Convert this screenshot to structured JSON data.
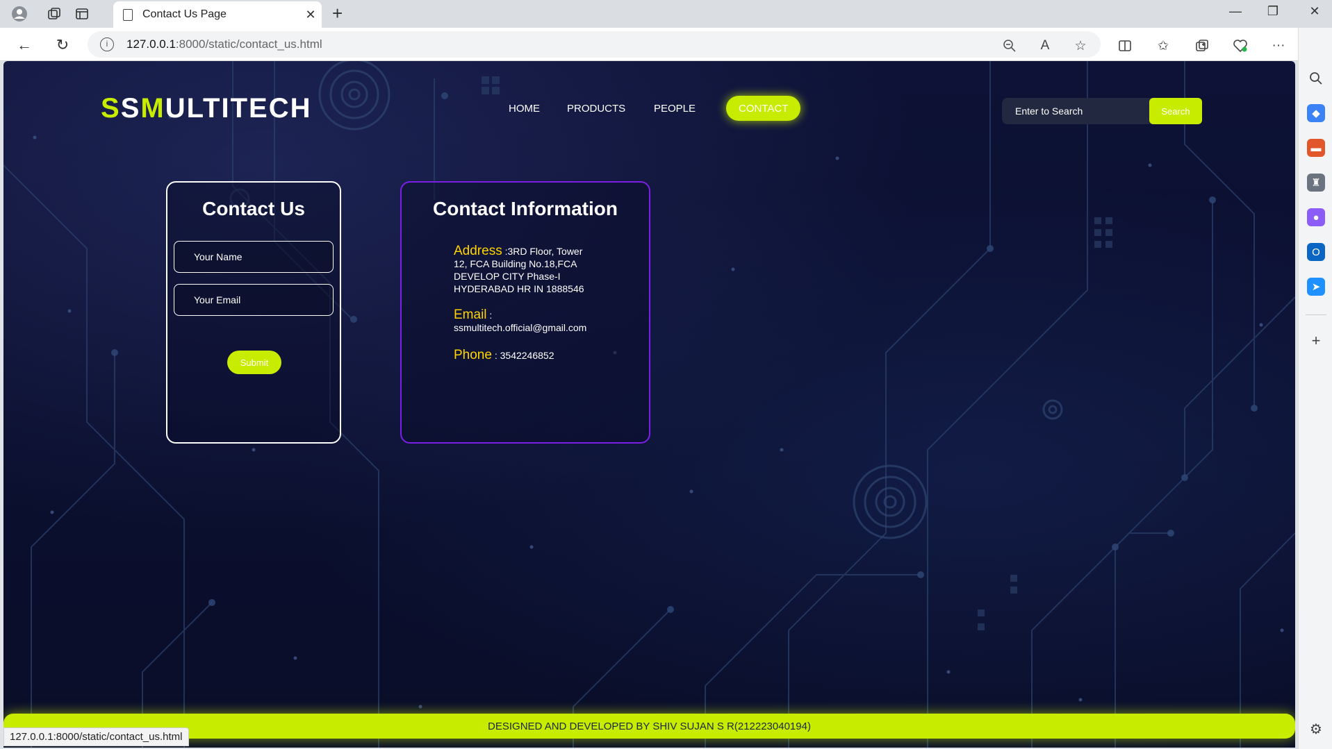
{
  "browser": {
    "tab_title": "Contact Us Page",
    "url_host": "127.0.0.1",
    "url_path": ":8000/static/contact_us.html",
    "status_url": "127.0.0.1:8000/static/contact_us.html"
  },
  "header": {
    "logo_prefix_1": "S",
    "logo_prefix_2": "S",
    "logo_prefix_3": "M",
    "logo_rest": "ULTITECH",
    "nav": {
      "home": "HOME",
      "products": "PRODUCTS",
      "people": "PEOPLE",
      "contact": "CONTACT"
    },
    "search_placeholder": "Enter to Search",
    "search_button": "Search"
  },
  "contact_form": {
    "title": "Contact Us",
    "name_placeholder": "Your Name",
    "email_placeholder": "Your Email",
    "submit_label": "Submit"
  },
  "contact_info": {
    "title": "Contact Information",
    "address_label": "Address",
    "address_first": " :3RD Floor, Tower",
    "address_rest": "12, FCA Building No.18,FCA DEVELOP CITY Phase-I HYDERABAD HR IN 1888546",
    "email_label": "Email",
    "email_sep": " :",
    "email_value": "ssmultitech.official@gmail.com",
    "phone_label": "Phone",
    "phone_value": " : 3542246852"
  },
  "footer": {
    "text": "DESIGNED AND DEVELOPED BY SHIV SUJAN S R(212223040194)"
  },
  "colors": {
    "accent": "#c8ec00",
    "info_border": "#7b1fe6",
    "label_yellow": "#ffd400",
    "page_bg": "#0b1030"
  }
}
